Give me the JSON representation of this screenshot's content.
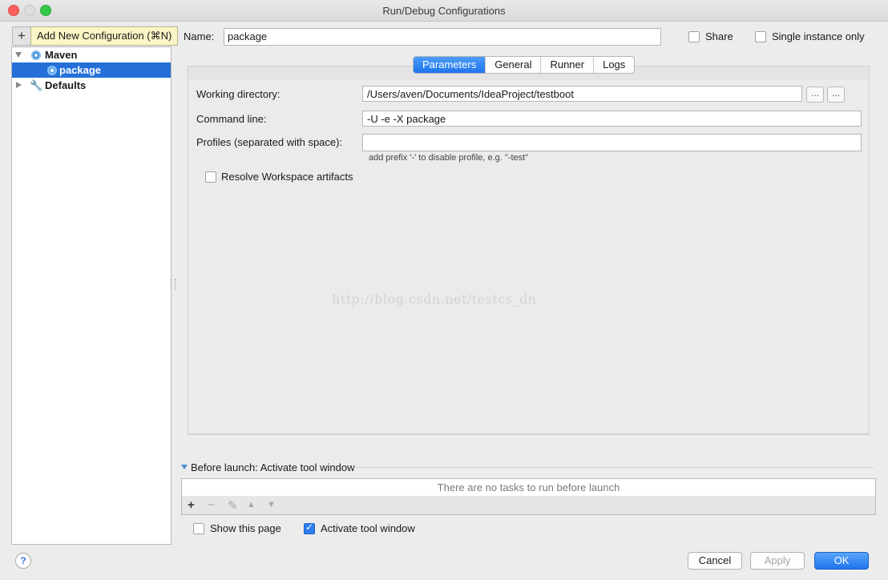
{
  "window": {
    "title": "Run/Debug Configurations"
  },
  "toolbar": {
    "add_glyph": "+",
    "tooltip": "Add New Configuration (⌘N)"
  },
  "tree": {
    "items": [
      {
        "label": "Maven"
      },
      {
        "label": "package"
      },
      {
        "label": "Defaults"
      }
    ]
  },
  "header": {
    "name_label": "Name:",
    "name_value": "package",
    "share_label": "Share",
    "single_instance_label": "Single instance only"
  },
  "tabs": [
    {
      "label": "Parameters"
    },
    {
      "label": "General"
    },
    {
      "label": "Runner"
    },
    {
      "label": "Logs"
    }
  ],
  "parameters": {
    "working_dir_label": "Working directory:",
    "working_dir_value": "/Users/aven/Documents/IdeaProject/testboot",
    "dots": "...",
    "command_line_label": "Command line:",
    "command_line_value": "-U -e -X package",
    "profiles_label": "Profiles (separated with space):",
    "profiles_value": "",
    "profiles_hint": "add prefix '-' to disable profile, e.g. \"-test\"",
    "resolve_label": "Resolve Workspace artifacts"
  },
  "watermark": "http://blog.csdn.net/testcs_dn",
  "before_launch": {
    "title": "Before launch: Activate tool window",
    "empty_text": "There are no tasks to run before launch",
    "icons": [
      "+",
      "−",
      "✎",
      "▲",
      "▼"
    ]
  },
  "footer": {
    "show_page_label": "Show this page",
    "activate_label": "Activate tool window",
    "help": "?",
    "cancel": "Cancel",
    "apply": "Apply",
    "ok": "OK"
  }
}
